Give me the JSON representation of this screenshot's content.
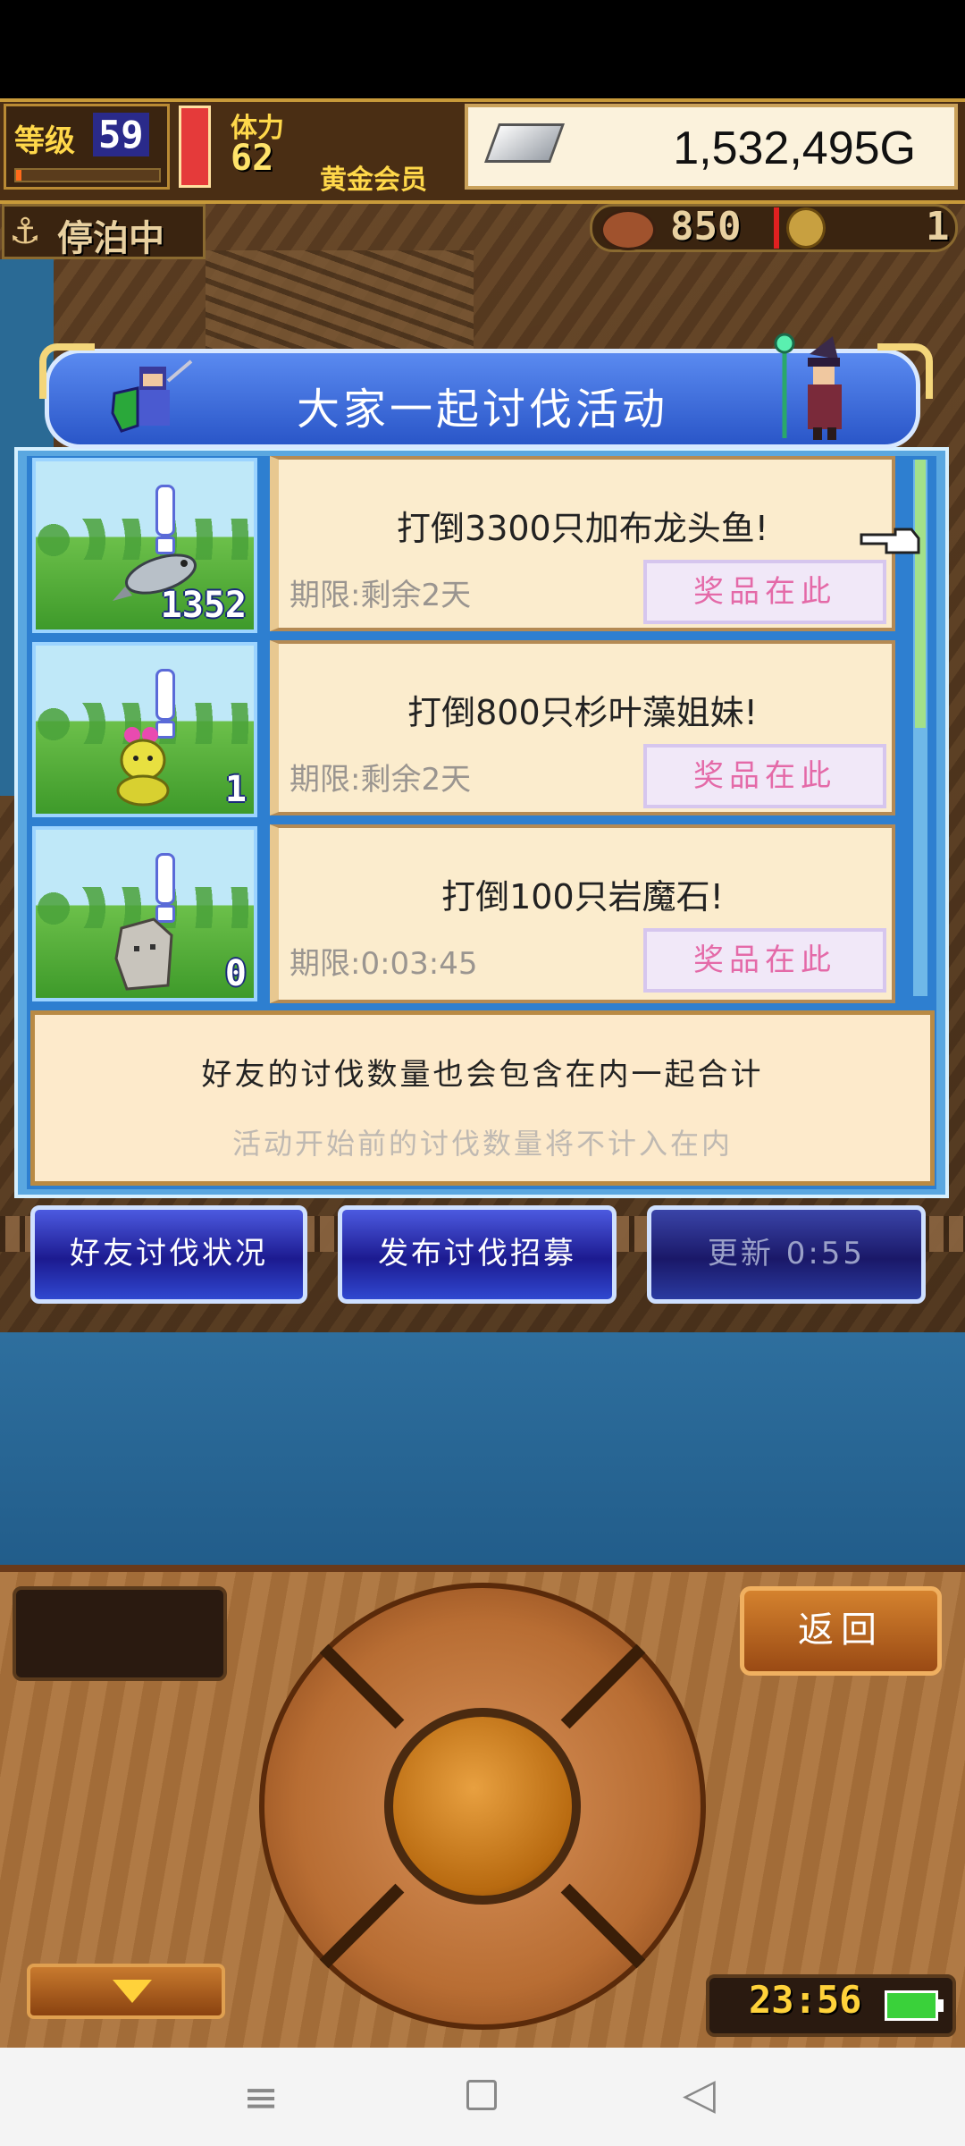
{
  "hud": {
    "level_label": "等级",
    "level_value": "59",
    "level_progress": 0.04,
    "stamina_label": "体力",
    "stamina_value": "62",
    "member_label": "黄金会员",
    "gold_value": "1,532,495G",
    "docked_label": "停泊中",
    "food_value": "850",
    "medal_value": "1"
  },
  "event": {
    "title": "大家一起讨伐活动",
    "quests": [
      {
        "count": "1352",
        "title": "打倒3300只加布龙头鱼!",
        "deadline": "期限:剩余2天",
        "reward_label": "奖品在此"
      },
      {
        "count": "1",
        "title": "打倒800只杉叶藻姐妹!",
        "deadline": "期限:剩余2天",
        "reward_label": "奖品在此"
      },
      {
        "count": "0",
        "title": "打倒100只岩魔石!",
        "deadline": "期限:0:03:45",
        "reward_label": "奖品在此"
      }
    ],
    "info_line1": "好友的讨伐数量也会包含在内一起合计",
    "info_line2": "活动开始前的讨伐数量将不计入在内"
  },
  "buttons": {
    "friends_label": "好友讨伐状况",
    "recruit_label": "发布讨伐招募",
    "refresh_label": "更新 0:55",
    "back_label": "返回"
  },
  "clock": {
    "time": "23:56"
  },
  "colors": {
    "panel_blue": "#2e7fd0",
    "reward_text": "#e46aa8",
    "clock_yellow": "#ffd23a"
  },
  "icons": {
    "nav_menu": "≡",
    "nav_back": "◁",
    "anchor": "⚓"
  }
}
